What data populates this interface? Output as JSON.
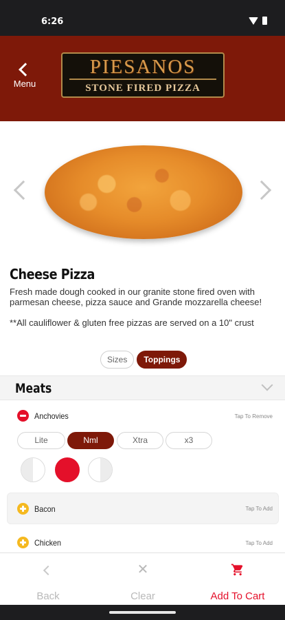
{
  "status_bar": {
    "time": "6:26",
    "icons": [
      "wifi-icon",
      "battery-icon"
    ]
  },
  "header": {
    "back_label": "Menu",
    "logo": {
      "main": "PIESANOS",
      "sub": "STONE FIRED PIZZA"
    },
    "background": "#7e1909"
  },
  "carousel": {
    "prev_icon": "chevron-left-icon",
    "next_icon": "chevron-right-icon",
    "image": "cheese-pizza"
  },
  "item": {
    "title": "Cheese Pizza",
    "description": "Fresh made dough cooked in our granite stone fired oven with parmesan cheese, pizza sauce and Grande mozzarella cheese!",
    "note": "**All cauliflower & gluten free pizzas are served on a 10\" crust"
  },
  "tabs": [
    {
      "label": "Sizes",
      "selected": false
    },
    {
      "label": "Toppings",
      "selected": true
    }
  ],
  "section": {
    "title": "Meats",
    "toppings": [
      {
        "name": "Anchovies",
        "action": "Tap To Remove",
        "selected": true
      },
      {
        "name": "Bacon",
        "action": "Tap To Add",
        "selected": false
      },
      {
        "name": "Chicken",
        "action": "Tap To Add",
        "selected": false
      }
    ],
    "amounts": [
      {
        "label": "Lite",
        "selected": false
      },
      {
        "label": "Nml",
        "selected": true
      },
      {
        "label": "Xtra",
        "selected": false
      },
      {
        "label": "x3",
        "selected": false
      }
    ],
    "placement": [
      "left-half",
      "whole",
      "right-half"
    ],
    "selected_placement": "whole"
  },
  "bottom_bar": {
    "back": "Back",
    "clear": "Clear",
    "add_to_cart": "Add To Cart"
  },
  "colors": {
    "accent": "#7e1909",
    "red": "#e4102a",
    "add": "#f5b920"
  }
}
